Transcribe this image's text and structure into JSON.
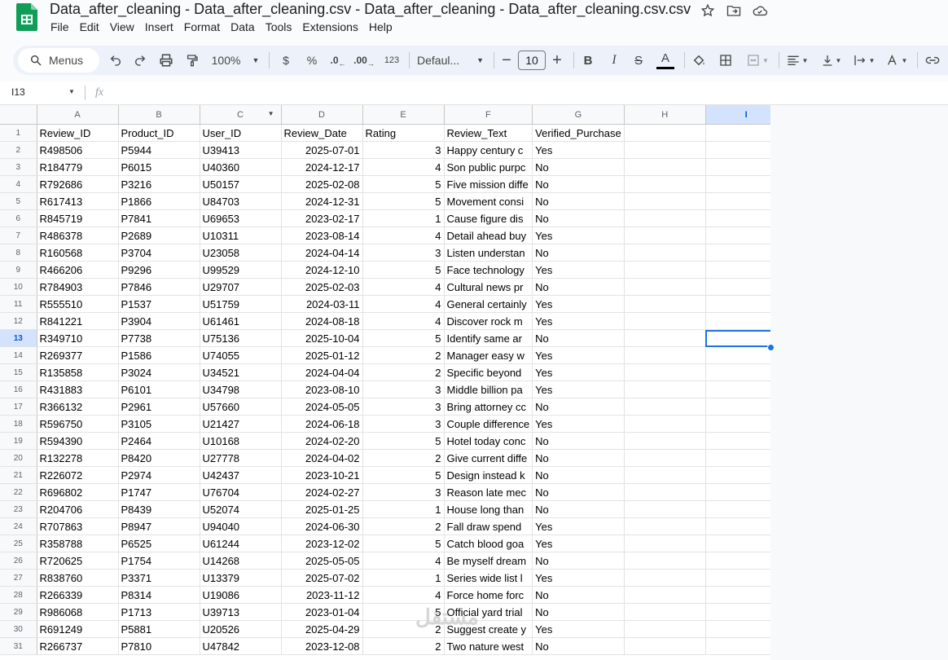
{
  "app": {
    "doc_title": "Data_after_cleaning - Data_after_cleaning.csv - Data_after_cleaning - Data_after_cleaning.csv.csv",
    "menu": [
      "File",
      "Edit",
      "View",
      "Insert",
      "Format",
      "Data",
      "Tools",
      "Extensions",
      "Help"
    ]
  },
  "toolbar": {
    "menus_label": "Menus",
    "zoom": "100%",
    "currency": "$",
    "percent": "%",
    "dec_decrease": ".0",
    "dec_increase": ".00",
    "number_format": "123",
    "font": "Defaul...",
    "font_size": "10",
    "bold": "B",
    "italic": "I",
    "strike": "S",
    "text_color": "A"
  },
  "formula_bar": {
    "name_box": "I13",
    "fx": "fx",
    "value": ""
  },
  "columns": [
    "A",
    "B",
    "C",
    "D",
    "E",
    "F",
    "G",
    "H",
    "I"
  ],
  "selected_cell": {
    "col": "I",
    "row": 13
  },
  "headers": [
    "Review_ID",
    "Product_ID",
    "User_ID",
    "Review_Date",
    "Rating",
    "Review_Text",
    "Verified_Purchase"
  ],
  "rows": [
    [
      "R498506",
      "P5944",
      "U39413",
      "2025-07-01",
      "3",
      "Happy century c",
      "Yes"
    ],
    [
      "R184779",
      "P6015",
      "U40360",
      "2024-12-17",
      "4",
      "Son public purpc",
      "No"
    ],
    [
      "R792686",
      "P3216",
      "U50157",
      "2025-02-08",
      "5",
      "Five mission diffe",
      "No"
    ],
    [
      "R617413",
      "P1866",
      "U84703",
      "2024-12-31",
      "5",
      "Movement consi",
      "No"
    ],
    [
      "R845719",
      "P7841",
      "U69653",
      "2023-02-17",
      "1",
      "Cause figure dis",
      "No"
    ],
    [
      "R486378",
      "P2689",
      "U10311",
      "2023-08-14",
      "4",
      "Detail ahead buy",
      "Yes"
    ],
    [
      "R160568",
      "P3704",
      "U23058",
      "2024-04-14",
      "3",
      "Listen understan",
      "No"
    ],
    [
      "R466206",
      "P9296",
      "U99529",
      "2024-12-10",
      "5",
      "Face technology",
      "Yes"
    ],
    [
      "R784903",
      "P7846",
      "U29707",
      "2025-02-03",
      "4",
      "Cultural news pr",
      "No"
    ],
    [
      "R555510",
      "P1537",
      "U51759",
      "2024-03-11",
      "4",
      "General certainly",
      "Yes"
    ],
    [
      "R841221",
      "P3904",
      "U61461",
      "2024-08-18",
      "4",
      "Discover rock m",
      "Yes"
    ],
    [
      "R349710",
      "P7738",
      "U75136",
      "2025-10-04",
      "5",
      "Identify same ar",
      "No"
    ],
    [
      "R269377",
      "P1586",
      "U74055",
      "2025-01-12",
      "2",
      "Manager easy w",
      "Yes"
    ],
    [
      "R135858",
      "P3024",
      "U34521",
      "2024-04-04",
      "2",
      "Specific beyond",
      "Yes"
    ],
    [
      "R431883",
      "P6101",
      "U34798",
      "2023-08-10",
      "3",
      "Middle billion pa",
      "Yes"
    ],
    [
      "R366132",
      "P2961",
      "U57660",
      "2024-05-05",
      "3",
      "Bring attorney cc",
      "No"
    ],
    [
      "R596750",
      "P3105",
      "U21427",
      "2024-06-18",
      "3",
      "Couple difference",
      "Yes"
    ],
    [
      "R594390",
      "P2464",
      "U10168",
      "2024-02-20",
      "5",
      "Hotel today conc",
      "No"
    ],
    [
      "R132278",
      "P8420",
      "U27778",
      "2024-04-02",
      "2",
      "Give current diffe",
      "No"
    ],
    [
      "R226072",
      "P2974",
      "U42437",
      "2023-10-21",
      "5",
      "Design instead k",
      "No"
    ],
    [
      "R696802",
      "P1747",
      "U76704",
      "2024-02-27",
      "3",
      "Reason late mec",
      "No"
    ],
    [
      "R204706",
      "P8439",
      "U52074",
      "2025-01-25",
      "1",
      "House long than",
      "No"
    ],
    [
      "R707863",
      "P8947",
      "U94040",
      "2024-06-30",
      "2",
      "Fall draw spend",
      "Yes"
    ],
    [
      "R358788",
      "P6525",
      "U61244",
      "2023-12-02",
      "5",
      "Catch blood goa",
      "Yes"
    ],
    [
      "R720625",
      "P1754",
      "U14268",
      "2025-05-05",
      "4",
      "Be myself dream",
      "No"
    ],
    [
      "R838760",
      "P3371",
      "U13379",
      "2025-07-02",
      "1",
      "Series wide list l",
      "Yes"
    ],
    [
      "R266339",
      "P8314",
      "U19086",
      "2023-11-12",
      "4",
      "Force home forc",
      "No"
    ],
    [
      "R986068",
      "P1713",
      "U39713",
      "2023-01-04",
      "5",
      "Official yard trial",
      "No"
    ],
    [
      "R691249",
      "P5881",
      "U20526",
      "2025-04-29",
      "2",
      "Suggest create y",
      "Yes"
    ],
    [
      "R266737",
      "P7810",
      "U47842",
      "2023-12-08",
      "2",
      "Two nature west",
      "No"
    ]
  ],
  "watermark": "مستقل",
  "colors": {
    "accent": "#0b57d0",
    "selection": "#1a73e8",
    "sheets_green": "#0f9d58"
  }
}
